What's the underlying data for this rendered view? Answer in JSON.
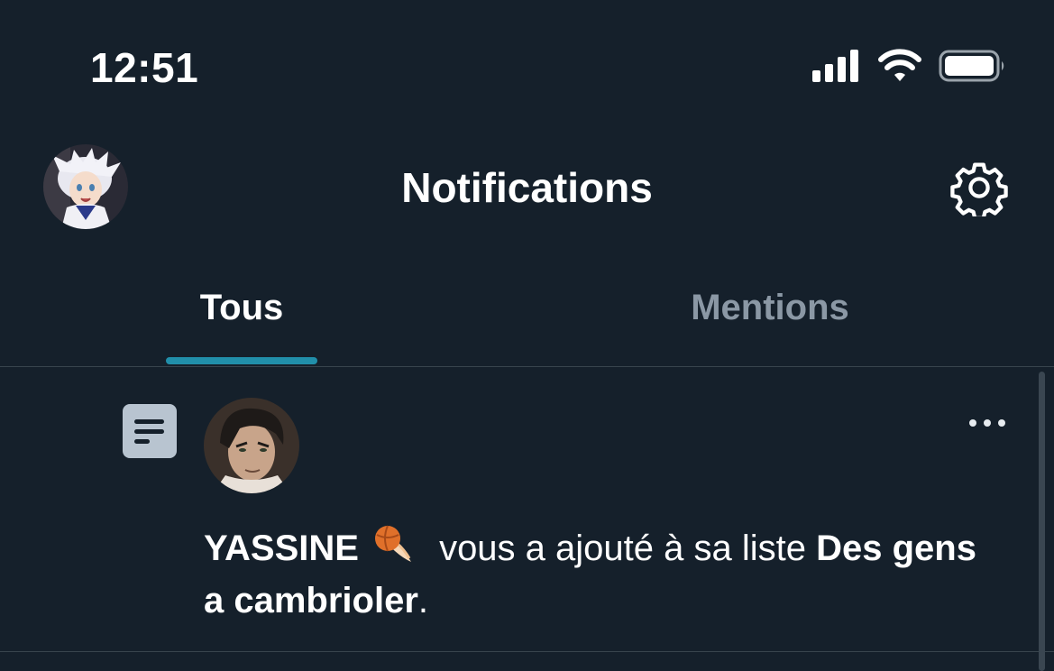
{
  "status_bar": {
    "time": "12:51",
    "icons": [
      "signal-icon",
      "wifi-icon",
      "battery-icon"
    ]
  },
  "header": {
    "title": "Notifications",
    "avatar": "profile-avatar",
    "settings_icon": "gear-icon"
  },
  "tabs": [
    {
      "label": "Tous",
      "active": true
    },
    {
      "label": "Mentions",
      "active": false
    }
  ],
  "notification": {
    "type_icon": "list-icon",
    "user_name": "YASSINE",
    "emoji": "comet-basketball-emoji",
    "action_text": "vous a ajouté à sa liste",
    "list_name": "Des gens a cambrioler",
    "end_punct": ".",
    "more_icon": "more-icon"
  },
  "colors": {
    "background": "#15202b",
    "accent": "#1d9bf0",
    "muted": "#8b98a5",
    "divider": "#38444d"
  }
}
